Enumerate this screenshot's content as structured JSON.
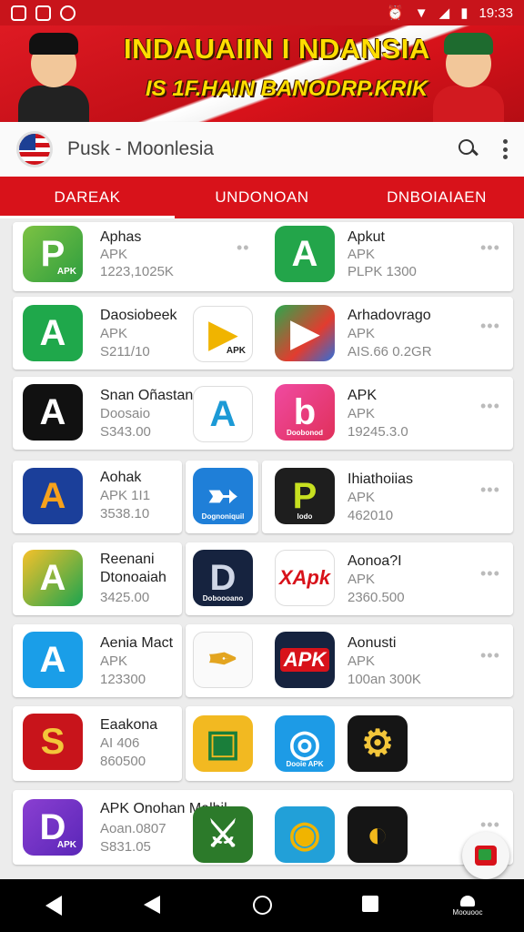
{
  "status_bar": {
    "time": "19:33"
  },
  "banner": {
    "title": "INDAUAIIN I NDANSIA",
    "subtitle": "IS 1F.HAIN BANODRP.KRIK"
  },
  "app_bar": {
    "title": "Pusk - Moonlesia"
  },
  "tabs": [
    {
      "label": "DAREAK",
      "active": true
    },
    {
      "label": "UNDONOAN",
      "active": false
    },
    {
      "label": "DNBOIAIAEN",
      "active": false
    }
  ],
  "items": {
    "r1a": {
      "name": "Aphas",
      "type": "APK",
      "meta": "1223,1025K",
      "icon_text": "APK"
    },
    "r1b": {
      "name": "Apkut",
      "type": "APK",
      "meta": "PLPK 1300"
    },
    "r2a": {
      "name": "Daosiobeek",
      "type": "APK",
      "meta": "S211/10"
    },
    "r2x": {
      "icon_text": "APK"
    },
    "r2b": {
      "name": "Arhadovrago",
      "type": "APK",
      "meta": "AIS.66 0.2GR"
    },
    "r3a": {
      "name": "Snan Oñastane",
      "type": "Doosaio",
      "meta": "S343.00"
    },
    "r3b": {
      "name": "APK",
      "type": "APK",
      "meta": "19245.3.0",
      "icon_text": "Doobonod"
    },
    "r4a": {
      "name": "Aohak",
      "type": "APK 1I1",
      "meta": "3538.10"
    },
    "r4x": {
      "icon_text": "Dognoniquil"
    },
    "r4b": {
      "name": "Ihiathoiias",
      "type": "APK",
      "meta": "462010",
      "icon_text": "lodo"
    },
    "r5a": {
      "name": "Reenani",
      "type": "Dtonoaiah",
      "meta": "3425.00"
    },
    "r5x": {
      "icon_text": "Doboooano"
    },
    "r5b": {
      "name": "Aonoa?I",
      "type": "APK",
      "meta": "2360.500",
      "icon_text": "XApk"
    },
    "r6a": {
      "name": "Aenia Mact",
      "type": "APK",
      "meta": "123300"
    },
    "r6b": {
      "name": "Aonusti",
      "type": "APK",
      "meta": "100an 300K",
      "icon_text": "APK"
    },
    "r7a": {
      "name": "Eaakona",
      "type": "AI 406",
      "meta": "860500"
    },
    "r7b": {
      "icon_text": "Dooie APK"
    },
    "r8a": {
      "name": "APK  Onohan Malhil",
      "type": "Aoan.0807",
      "meta": "S831.05",
      "icon_text": "APK"
    }
  },
  "colors": {
    "primary": "#d8121a",
    "status_bar": "#c8141b"
  },
  "icons": [
    "sd-card-icon",
    "image-icon",
    "whatsapp-icon",
    "alarm-icon",
    "wifi-icon",
    "signal-icon",
    "battery-icon",
    "flag-icon",
    "search-icon",
    "more-vert-icon"
  ],
  "nav": {
    "app_label": "Moouooc"
  }
}
